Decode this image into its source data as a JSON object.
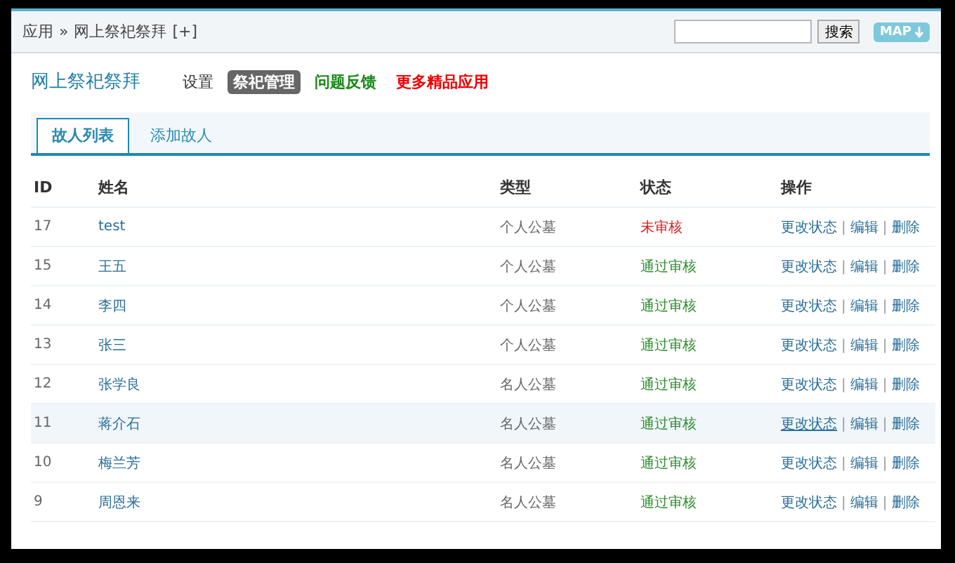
{
  "breadcrumb": {
    "items": [
      "应用",
      "网上祭祀祭拜"
    ],
    "separator": "»",
    "add": "[+]"
  },
  "search": {
    "button": "搜索"
  },
  "map_button": "MAP",
  "app_title": "网上祭祀祭拜",
  "nav": [
    {
      "label": "设置",
      "kind": "plain",
      "selected": false
    },
    {
      "label": "祭祀管理",
      "kind": "plain",
      "selected": true
    },
    {
      "label": "问题反馈",
      "kind": "green",
      "selected": false
    },
    {
      "label": "更多精品应用",
      "kind": "red",
      "selected": false
    }
  ],
  "tabs": [
    {
      "label": "故人列表",
      "selected": true
    },
    {
      "label": "添加故人",
      "selected": false
    }
  ],
  "table": {
    "action_separator": "|",
    "columns": [
      "ID",
      "姓名",
      "类型",
      "状态",
      "操作"
    ],
    "rows": [
      {
        "id": "17",
        "name": "test",
        "type": "个人公墓",
        "status": "未审核",
        "approved": false,
        "highlighted": false,
        "actions": [
          "更改状态",
          "编辑",
          "删除"
        ]
      },
      {
        "id": "15",
        "name": "王五",
        "type": "个人公墓",
        "status": "通过审核",
        "approved": true,
        "highlighted": false,
        "actions": [
          "更改状态",
          "编辑",
          "删除"
        ]
      },
      {
        "id": "14",
        "name": "李四",
        "type": "个人公墓",
        "status": "通过审核",
        "approved": true,
        "highlighted": false,
        "actions": [
          "更改状态",
          "编辑",
          "删除"
        ]
      },
      {
        "id": "13",
        "name": "张三",
        "type": "个人公墓",
        "status": "通过审核",
        "approved": true,
        "highlighted": false,
        "actions": [
          "更改状态",
          "编辑",
          "删除"
        ]
      },
      {
        "id": "12",
        "name": "张学良",
        "type": "名人公墓",
        "status": "通过审核",
        "approved": true,
        "highlighted": false,
        "actions": [
          "更改状态",
          "编辑",
          "删除"
        ]
      },
      {
        "id": "11",
        "name": "蒋介石",
        "type": "名人公墓",
        "status": "通过审核",
        "approved": true,
        "highlighted": true,
        "actions": [
          "更改状态",
          "编辑",
          "删除"
        ]
      },
      {
        "id": "10",
        "name": "梅兰芳",
        "type": "名人公墓",
        "status": "通过审核",
        "approved": true,
        "highlighted": false,
        "actions": [
          "更改状态",
          "编辑",
          "删除"
        ]
      },
      {
        "id": "9",
        "name": "周恩来",
        "type": "名人公墓",
        "status": "通过审核",
        "approved": true,
        "highlighted": false,
        "actions": [
          "更改状态",
          "编辑",
          "删除"
        ]
      }
    ]
  }
}
